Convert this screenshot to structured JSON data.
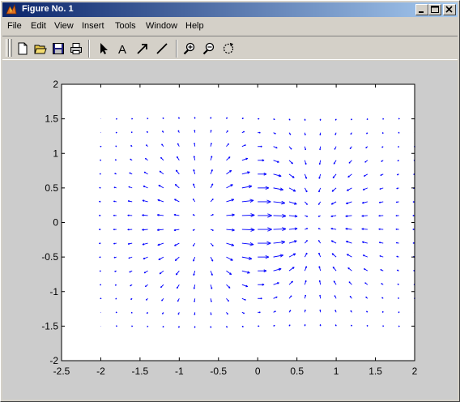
{
  "window": {
    "title": "Figure No. 1",
    "controls": {
      "minimize_icon": "minimize-icon",
      "maximize_icon": "maximize-icon",
      "close_icon": "close-icon"
    }
  },
  "menubar": {
    "items": [
      {
        "label": "File"
      },
      {
        "label": "Edit"
      },
      {
        "label": "View"
      },
      {
        "label": "Insert"
      },
      {
        "label": "Tools"
      },
      {
        "label": "Window"
      },
      {
        "label": "Help"
      }
    ]
  },
  "toolbar": {
    "items": [
      {
        "icon": "new-figure-icon"
      },
      {
        "icon": "open-file-icon"
      },
      {
        "icon": "save-icon"
      },
      {
        "icon": "print-icon"
      },
      {
        "icon": "select-arrow-icon"
      },
      {
        "icon": "insert-text-icon",
        "label": "A"
      },
      {
        "icon": "insert-arrow-icon"
      },
      {
        "icon": "insert-line-icon"
      },
      {
        "icon": "zoom-in-icon"
      },
      {
        "icon": "zoom-out-icon"
      },
      {
        "icon": "rotate-3d-icon"
      }
    ]
  },
  "colors": {
    "canvas": "#cccccc",
    "axes_bg": "#ffffff",
    "arrows": "#0000ff",
    "titlebar_start": "#0a246a",
    "titlebar_end": "#a6caf0"
  },
  "chart_data": {
    "type": "quiver",
    "title": "",
    "xlabel": "",
    "ylabel": "",
    "xlim": [
      -2.5,
      2
    ],
    "ylim": [
      -2,
      2
    ],
    "xticks": [
      -2.5,
      -2,
      -1.5,
      -1,
      -0.5,
      0,
      0.5,
      1,
      1.5,
      2
    ],
    "yticks": [
      -2,
      -1.5,
      -1,
      -0.5,
      0,
      0.5,
      1,
      1.5,
      2
    ],
    "grid": false,
    "field": {
      "description_of_source": "gradient of z = x*exp(-x^2-y^2)",
      "x_range": [
        -2,
        2
      ],
      "y_range": [
        -1.5,
        1.5
      ],
      "step": 0.2
    }
  }
}
